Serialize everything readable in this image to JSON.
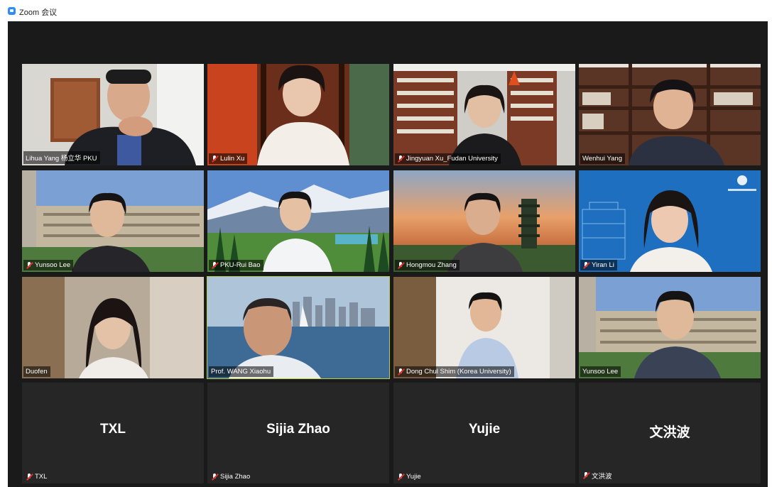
{
  "window": {
    "title": "Zoom 会议"
  },
  "participants": [
    {
      "name": "Lihua Yang 杨立华 PKU",
      "muted": false,
      "bg": "room-white"
    },
    {
      "name": "Lulin Xu",
      "muted": true,
      "bg": "room-wood"
    },
    {
      "name": "Jingyuan Xu_Fudan University",
      "muted": true,
      "bg": "bookshelf"
    },
    {
      "name": "Wenhui Yang",
      "muted": false,
      "bg": "bookshelf-dark"
    },
    {
      "name": "Yunsoo Lee",
      "muted": true,
      "bg": "campus"
    },
    {
      "name": "PKU-Rui Bao",
      "muted": true,
      "bg": "mountains"
    },
    {
      "name": "Hongmou Zhang",
      "muted": true,
      "bg": "pagoda-sunset"
    },
    {
      "name": "Yiran Li",
      "muted": true,
      "bg": "blue-logo"
    },
    {
      "name": "Duofen",
      "muted": false,
      "bg": "room-warm"
    },
    {
      "name": "Prof. WANG Xiaohu",
      "muted": false,
      "bg": "harbor-city",
      "speaking": true
    },
    {
      "name": "Dong Chul Shim (Korea University)",
      "muted": true,
      "bg": "room-bright"
    },
    {
      "name": "Yunsoo Lee",
      "muted": false,
      "bg": "campus"
    }
  ],
  "audio_only": [
    {
      "display": "TXL",
      "name": "TXL",
      "muted": true
    },
    {
      "display": "Sijia Zhao",
      "name": "Sijia Zhao",
      "muted": true
    },
    {
      "display": "Yujie",
      "name": "Yujie",
      "muted": true
    },
    {
      "display": "文洪波",
      "name": "文洪波",
      "muted": true
    }
  ]
}
